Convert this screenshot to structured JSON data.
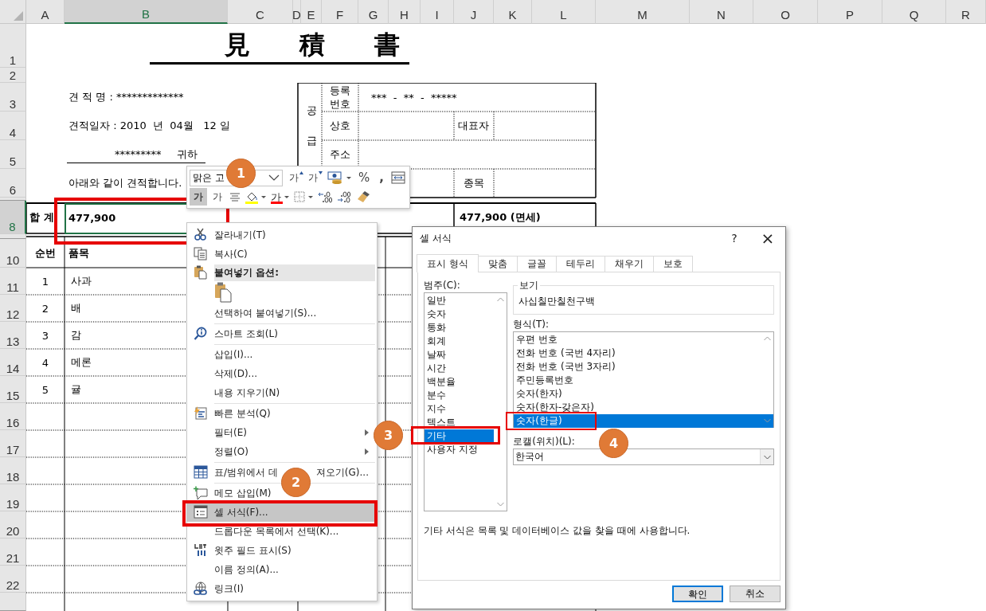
{
  "sheet": {
    "column_headers": [
      {
        "label": "A",
        "selected": false
      },
      {
        "label": "B",
        "selected": true
      },
      {
        "label": "C",
        "selected": false
      },
      {
        "label": "D",
        "selected": false
      },
      {
        "label": "E",
        "selected": false
      },
      {
        "label": "F",
        "selected": false
      },
      {
        "label": "G",
        "selected": false
      },
      {
        "label": "H",
        "selected": false
      },
      {
        "label": "I",
        "selected": false
      },
      {
        "label": "J",
        "selected": false
      },
      {
        "label": "K",
        "selected": false
      },
      {
        "label": "L",
        "selected": false
      },
      {
        "label": "M",
        "selected": false
      },
      {
        "label": "N",
        "selected": false
      },
      {
        "label": "O",
        "selected": false
      },
      {
        "label": "P",
        "selected": false
      },
      {
        "label": "Q",
        "selected": false
      },
      {
        "label": "R",
        "selected": false
      }
    ],
    "row_headers": [
      {
        "label": "1",
        "selected": false
      },
      {
        "label": "2",
        "selected": false
      },
      {
        "label": "3",
        "selected": false
      },
      {
        "label": "4",
        "selected": false
      },
      {
        "label": "5",
        "selected": false
      },
      {
        "label": "6",
        "selected": false
      },
      {
        "label": "8",
        "selected": true
      },
      {
        "label": "10",
        "selected": false
      },
      {
        "label": "11",
        "selected": false
      },
      {
        "label": "12",
        "selected": false
      },
      {
        "label": "13",
        "selected": false
      },
      {
        "label": "14",
        "selected": false
      },
      {
        "label": "15",
        "selected": false
      },
      {
        "label": "16",
        "selected": false
      },
      {
        "label": "17",
        "selected": false
      },
      {
        "label": "18",
        "selected": false
      },
      {
        "label": "19",
        "selected": false
      },
      {
        "label": "20",
        "selected": false
      },
      {
        "label": "21",
        "selected": false
      },
      {
        "label": "22",
        "selected": false
      }
    ],
    "title": [
      "見",
      "積",
      "書"
    ],
    "quote_name": "견 적 명 : *************",
    "quote_date": "견적일자 : 2010  년  04월   12 일",
    "recipient": "*********",
    "honorific": "귀하",
    "greeting": "아래와 같이 견적합니다.",
    "supplier": {
      "label": "공급",
      "registration_label": "등록\n번호",
      "registration_number": "***  -  **  -  *****",
      "company_label": "상호",
      "representative_label": "대표자",
      "address_label": "주소",
      "business_item_label": "종목"
    },
    "total_label": "합 계",
    "total": "477,900",
    "total_note": "477,900 (면세)",
    "item_headers": [
      "순번",
      "품목"
    ],
    "items": [
      {
        "no": "1",
        "name": "사과"
      },
      {
        "no": "2",
        "name": "배"
      },
      {
        "no": "3",
        "name": "감"
      },
      {
        "no": "4",
        "name": "메론"
      },
      {
        "no": "5",
        "name": "귤"
      }
    ]
  },
  "mini_toolbar": {
    "font": "맑은 고",
    "row1": [
      {
        "kind": "grow-font",
        "label": "가"
      },
      {
        "kind": "shrink-font",
        "label": "가"
      },
      {
        "kind": "accounting"
      },
      {
        "kind": "percent",
        "label": "%"
      },
      {
        "kind": "comma",
        "label": ","
      },
      {
        "kind": "merge"
      }
    ],
    "row2": [
      {
        "kind": "bold",
        "label": "가",
        "on": true
      },
      {
        "kind": "italic",
        "label": "가",
        "on": false
      },
      {
        "kind": "align"
      },
      {
        "kind": "fill-color",
        "color": "#ffff00"
      },
      {
        "kind": "font-color",
        "label": "가",
        "color": "#ff0000"
      },
      {
        "kind": "borders"
      },
      {
        "kind": "increase-decimal"
      },
      {
        "kind": "decrease-decimal"
      },
      {
        "kind": "format-painter"
      }
    ]
  },
  "context_menu": {
    "items": [
      {
        "kind": "item",
        "label": "잘라내기(T)",
        "selected": false
      },
      {
        "kind": "item",
        "label": "복사(C)",
        "selected": false
      },
      {
        "kind": "header",
        "label": "붙여넣기 옵션:"
      },
      {
        "kind": "paste-options"
      },
      {
        "kind": "item",
        "label": "선택하여 붙여넣기(S)...",
        "selected": false
      },
      {
        "kind": "item",
        "label": "스마트 조회(L)",
        "selected": false,
        "separator_before": true
      },
      {
        "kind": "item",
        "label": "삽입(I)...",
        "selected": false,
        "separator_before": true
      },
      {
        "kind": "item",
        "label": "삭제(D)...",
        "selected": false
      },
      {
        "kind": "item",
        "label": "내용 지우기(N)",
        "selected": false
      },
      {
        "kind": "item",
        "label": "빠른 분석(Q)",
        "selected": false,
        "separator_before": true
      },
      {
        "kind": "item",
        "label": "필터(E)",
        "selected": false,
        "submenu": true
      },
      {
        "kind": "item",
        "label": "정렬(O)",
        "selected": false,
        "submenu": true
      },
      {
        "kind": "item",
        "label": "표/범위에서 데",
        "label_tail": "져오기(G)...",
        "selected": false,
        "separator_before": true
      },
      {
        "kind": "item",
        "label": "메모 삽입(M)",
        "selected": false,
        "separator_before": true
      },
      {
        "kind": "item",
        "label": "셀 서식(F)...",
        "selected": true
      },
      {
        "kind": "item",
        "label": "드롭다운 목록에서 선택(K)...",
        "selected": false
      },
      {
        "kind": "item",
        "label": "윗주 필드 표시(S)",
        "selected": false
      },
      {
        "kind": "item",
        "label": "이름 정의(A)...",
        "selected": false
      },
      {
        "kind": "item",
        "label": "링크(I)",
        "selected": false
      }
    ]
  },
  "dialog": {
    "title": "셀 서식",
    "help": "?",
    "close": "×",
    "tabs": [
      {
        "label": "표시 형식",
        "selected": true
      },
      {
        "label": "맞춤",
        "selected": false
      },
      {
        "label": "글꼴",
        "selected": false
      },
      {
        "label": "테두리",
        "selected": false
      },
      {
        "label": "채우기",
        "selected": false
      },
      {
        "label": "보호",
        "selected": false
      }
    ],
    "category_label": "범주(C):",
    "categories": [
      {
        "label": "일반",
        "selected": false
      },
      {
        "label": "숫자",
        "selected": false
      },
      {
        "label": "통화",
        "selected": false
      },
      {
        "label": "회계",
        "selected": false
      },
      {
        "label": "날짜",
        "selected": false
      },
      {
        "label": "시간",
        "selected": false
      },
      {
        "label": "백분율",
        "selected": false
      },
      {
        "label": "분수",
        "selected": false
      },
      {
        "label": "지수",
        "selected": false
      },
      {
        "label": "텍스트",
        "selected": false
      },
      {
        "label": "기타",
        "selected": true
      },
      {
        "label": "사용자 지정",
        "selected": false
      }
    ],
    "sample_label": "보기",
    "sample": "사십칠만칠천구백",
    "type_label": "형식(T):",
    "types": [
      {
        "label": "우편 번호",
        "selected": false
      },
      {
        "label": "전화 번호 (국번 4자리)",
        "selected": false
      },
      {
        "label": "전화 번호 (국번 3자리)",
        "selected": false
      },
      {
        "label": "주민등록번호",
        "selected": false
      },
      {
        "label": "숫자(한자)",
        "selected": false
      },
      {
        "label": "숫자(한자-갖은자)",
        "selected": false
      },
      {
        "label": "숫자(한글)",
        "selected": true
      }
    ],
    "locale_label": "로캘(위치)(L):",
    "locale": "한국어",
    "description": "기타 서식은 목록 및 데이터베이스 값을 찾을 때에 사용합니다.",
    "buttons": [
      {
        "label": "확인",
        "default": true
      },
      {
        "label": "취소",
        "default": false
      }
    ]
  },
  "callouts": [
    {
      "label": "1"
    },
    {
      "label": "2"
    },
    {
      "label": "3"
    },
    {
      "label": "4"
    }
  ]
}
